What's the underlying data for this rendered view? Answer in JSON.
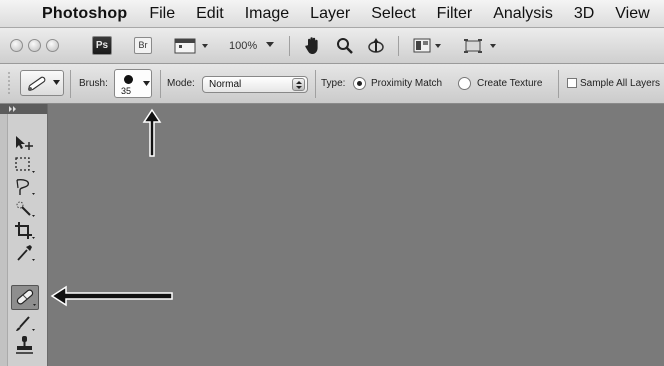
{
  "menubar": {
    "app_name": "Photoshop",
    "menus": [
      "File",
      "Edit",
      "Image",
      "Layer",
      "Select",
      "Filter",
      "Analysis",
      "3D",
      "View"
    ]
  },
  "appbar": {
    "ps_label": "Ps",
    "br_label": "Br",
    "zoom": "100%"
  },
  "options": {
    "brush_label": "Brush:",
    "brush_size": "35",
    "mode_label": "Mode:",
    "mode_value": "Normal",
    "type_label": "Type:",
    "type_options": [
      "Proximity Match",
      "Create Texture"
    ],
    "type_selected": "Proximity Match",
    "sample_all_layers_label": "Sample All Layers"
  },
  "tools": {
    "selected": "spot-healing-brush-tool",
    "items": [
      "move-tool",
      "marquee-tool",
      "lasso-tool",
      "quick-selection-tool",
      "crop-tool",
      "eyedropper-tool",
      "spot-healing-brush-tool",
      "brush-tool",
      "clone-stamp-tool"
    ]
  },
  "annotations": [
    "arrow-pointing-to-brush-picker",
    "arrow-pointing-to-spot-healing-brush-tool"
  ]
}
